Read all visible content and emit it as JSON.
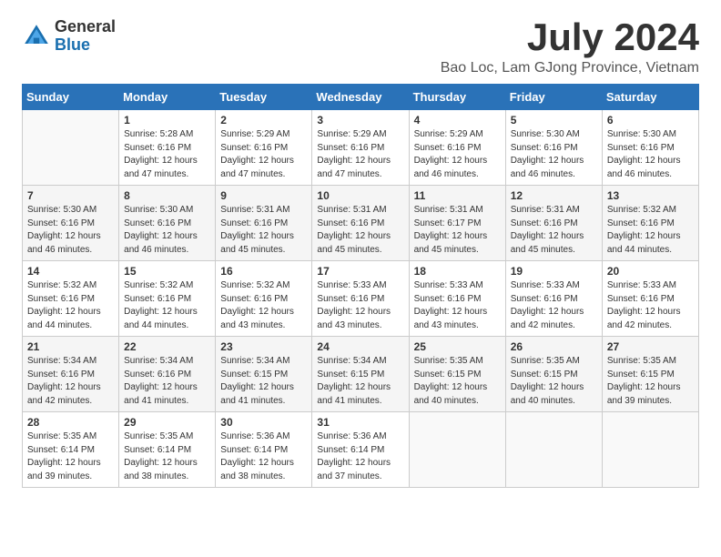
{
  "logo": {
    "general": "General",
    "blue": "Blue"
  },
  "header": {
    "title": "July 2024",
    "subtitle": "Bao Loc, Lam GJong Province, Vietnam"
  },
  "calendar": {
    "days_of_week": [
      "Sunday",
      "Monday",
      "Tuesday",
      "Wednesday",
      "Thursday",
      "Friday",
      "Saturday"
    ],
    "weeks": [
      [
        {
          "day": "",
          "info": ""
        },
        {
          "day": "1",
          "info": "Sunrise: 5:28 AM\nSunset: 6:16 PM\nDaylight: 12 hours\nand 47 minutes."
        },
        {
          "day": "2",
          "info": "Sunrise: 5:29 AM\nSunset: 6:16 PM\nDaylight: 12 hours\nand 47 minutes."
        },
        {
          "day": "3",
          "info": "Sunrise: 5:29 AM\nSunset: 6:16 PM\nDaylight: 12 hours\nand 47 minutes."
        },
        {
          "day": "4",
          "info": "Sunrise: 5:29 AM\nSunset: 6:16 PM\nDaylight: 12 hours\nand 46 minutes."
        },
        {
          "day": "5",
          "info": "Sunrise: 5:30 AM\nSunset: 6:16 PM\nDaylight: 12 hours\nand 46 minutes."
        },
        {
          "day": "6",
          "info": "Sunrise: 5:30 AM\nSunset: 6:16 PM\nDaylight: 12 hours\nand 46 minutes."
        }
      ],
      [
        {
          "day": "7",
          "info": "Sunrise: 5:30 AM\nSunset: 6:16 PM\nDaylight: 12 hours\nand 46 minutes."
        },
        {
          "day": "8",
          "info": "Sunrise: 5:30 AM\nSunset: 6:16 PM\nDaylight: 12 hours\nand 46 minutes."
        },
        {
          "day": "9",
          "info": "Sunrise: 5:31 AM\nSunset: 6:16 PM\nDaylight: 12 hours\nand 45 minutes."
        },
        {
          "day": "10",
          "info": "Sunrise: 5:31 AM\nSunset: 6:16 PM\nDaylight: 12 hours\nand 45 minutes."
        },
        {
          "day": "11",
          "info": "Sunrise: 5:31 AM\nSunset: 6:17 PM\nDaylight: 12 hours\nand 45 minutes."
        },
        {
          "day": "12",
          "info": "Sunrise: 5:31 AM\nSunset: 6:16 PM\nDaylight: 12 hours\nand 45 minutes."
        },
        {
          "day": "13",
          "info": "Sunrise: 5:32 AM\nSunset: 6:16 PM\nDaylight: 12 hours\nand 44 minutes."
        }
      ],
      [
        {
          "day": "14",
          "info": "Sunrise: 5:32 AM\nSunset: 6:16 PM\nDaylight: 12 hours\nand 44 minutes."
        },
        {
          "day": "15",
          "info": "Sunrise: 5:32 AM\nSunset: 6:16 PM\nDaylight: 12 hours\nand 44 minutes."
        },
        {
          "day": "16",
          "info": "Sunrise: 5:32 AM\nSunset: 6:16 PM\nDaylight: 12 hours\nand 43 minutes."
        },
        {
          "day": "17",
          "info": "Sunrise: 5:33 AM\nSunset: 6:16 PM\nDaylight: 12 hours\nand 43 minutes."
        },
        {
          "day": "18",
          "info": "Sunrise: 5:33 AM\nSunset: 6:16 PM\nDaylight: 12 hours\nand 43 minutes."
        },
        {
          "day": "19",
          "info": "Sunrise: 5:33 AM\nSunset: 6:16 PM\nDaylight: 12 hours\nand 42 minutes."
        },
        {
          "day": "20",
          "info": "Sunrise: 5:33 AM\nSunset: 6:16 PM\nDaylight: 12 hours\nand 42 minutes."
        }
      ],
      [
        {
          "day": "21",
          "info": "Sunrise: 5:34 AM\nSunset: 6:16 PM\nDaylight: 12 hours\nand 42 minutes."
        },
        {
          "day": "22",
          "info": "Sunrise: 5:34 AM\nSunset: 6:16 PM\nDaylight: 12 hours\nand 41 minutes."
        },
        {
          "day": "23",
          "info": "Sunrise: 5:34 AM\nSunset: 6:15 PM\nDaylight: 12 hours\nand 41 minutes."
        },
        {
          "day": "24",
          "info": "Sunrise: 5:34 AM\nSunset: 6:15 PM\nDaylight: 12 hours\nand 41 minutes."
        },
        {
          "day": "25",
          "info": "Sunrise: 5:35 AM\nSunset: 6:15 PM\nDaylight: 12 hours\nand 40 minutes."
        },
        {
          "day": "26",
          "info": "Sunrise: 5:35 AM\nSunset: 6:15 PM\nDaylight: 12 hours\nand 40 minutes."
        },
        {
          "day": "27",
          "info": "Sunrise: 5:35 AM\nSunset: 6:15 PM\nDaylight: 12 hours\nand 39 minutes."
        }
      ],
      [
        {
          "day": "28",
          "info": "Sunrise: 5:35 AM\nSunset: 6:14 PM\nDaylight: 12 hours\nand 39 minutes."
        },
        {
          "day": "29",
          "info": "Sunrise: 5:35 AM\nSunset: 6:14 PM\nDaylight: 12 hours\nand 38 minutes."
        },
        {
          "day": "30",
          "info": "Sunrise: 5:36 AM\nSunset: 6:14 PM\nDaylight: 12 hours\nand 38 minutes."
        },
        {
          "day": "31",
          "info": "Sunrise: 5:36 AM\nSunset: 6:14 PM\nDaylight: 12 hours\nand 37 minutes."
        },
        {
          "day": "",
          "info": ""
        },
        {
          "day": "",
          "info": ""
        },
        {
          "day": "",
          "info": ""
        }
      ]
    ]
  }
}
